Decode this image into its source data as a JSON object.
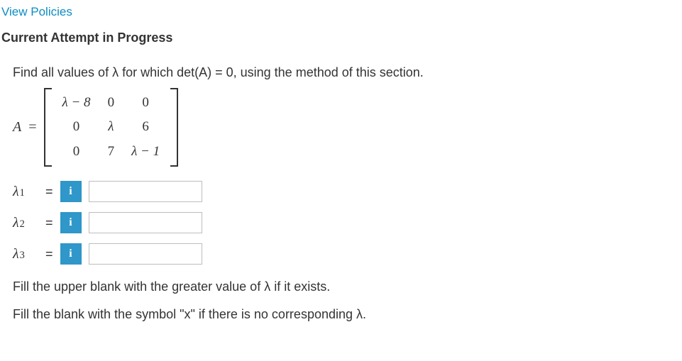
{
  "viewPoliciesLabel": "View Policies",
  "attemptHeading": "Current Attempt in Progress",
  "prompt": "Find all values of λ for which det(A) = 0, using the method of this section.",
  "matrixLabel": "A",
  "equals": "=",
  "matrix": {
    "r1c1": "λ − 8",
    "r1c2": "0",
    "r1c3": "0",
    "r2c1": "0",
    "r2c2": "λ",
    "r2c3": "6",
    "r3c1": "0",
    "r3c2": "7",
    "r3c3": "λ − 1"
  },
  "answers": {
    "lambda1": {
      "label": "λ",
      "sub": "1",
      "value": ""
    },
    "lambda2": {
      "label": "λ",
      "sub": "2",
      "value": ""
    },
    "lambda3": {
      "label": "λ",
      "sub": "3",
      "value": ""
    }
  },
  "infoIcon": "i",
  "instructions": {
    "line1": "Fill the upper blank with the greater value of λ if it exists.",
    "line2": "Fill the blank with the symbol \"x\" if there is no corresponding λ."
  }
}
